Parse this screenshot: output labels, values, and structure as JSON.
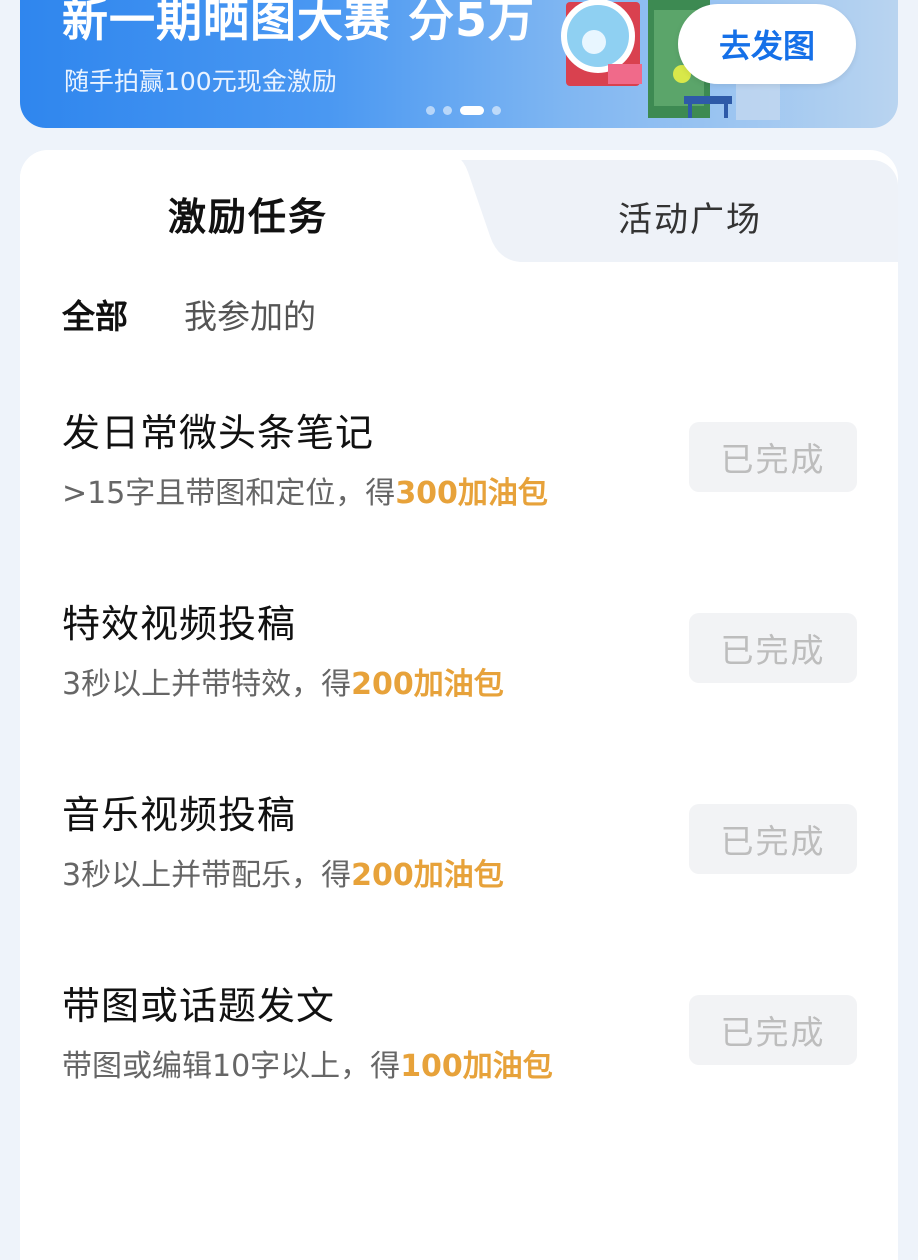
{
  "banner": {
    "title": "新一期晒图大赛 分5万",
    "subtitle": "随手拍赢100元现金激励",
    "cta": "去发图",
    "page_count": 4,
    "active_page": 3
  },
  "tabs": [
    {
      "label": "激励任务",
      "active": true
    },
    {
      "label": "活动广场",
      "active": false
    }
  ],
  "filters": [
    {
      "label": "全部",
      "active": true
    },
    {
      "label": "我参加的",
      "active": false
    }
  ],
  "tasks": [
    {
      "title": "发日常微头条笔记",
      "desc_prefix": ">15字且带图和定位，得",
      "reward": "300加油包",
      "status": "已完成"
    },
    {
      "title": "特效视频投稿",
      "desc_prefix": "3秒以上并带特效，得",
      "reward": "200加油包",
      "status": "已完成"
    },
    {
      "title": "音乐视频投稿",
      "desc_prefix": "3秒以上并带配乐，得",
      "reward": "200加油包",
      "status": "已完成"
    },
    {
      "title": "带图或话题发文",
      "desc_prefix": "带图或编辑10字以上，得",
      "reward": "100加油包",
      "status": "已完成"
    }
  ],
  "colors": {
    "accent_blue": "#1570e8",
    "reward_orange": "#e7a23a",
    "done_gray": "#bdbdbd"
  }
}
